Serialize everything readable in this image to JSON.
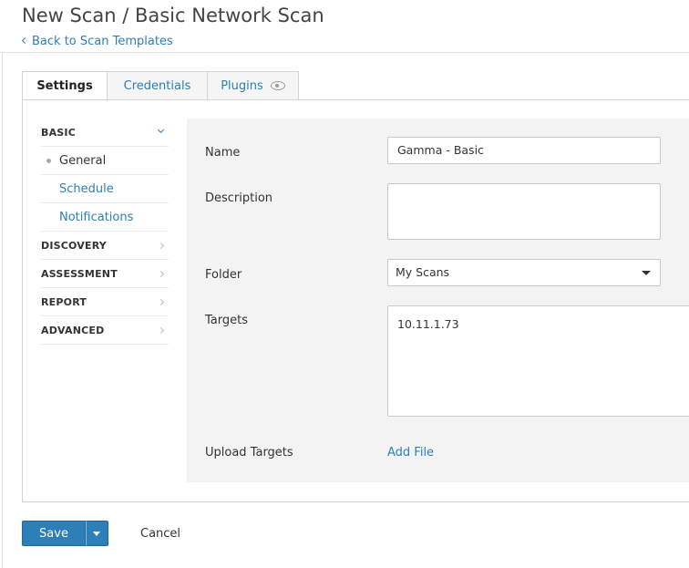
{
  "header": {
    "title": "New Scan / Basic Network Scan",
    "back_link": "Back to Scan Templates"
  },
  "tabs": [
    {
      "label": "Settings",
      "active": true
    },
    {
      "label": "Credentials",
      "active": false
    },
    {
      "label": "Plugins",
      "active": false,
      "icon": "eye-icon"
    }
  ],
  "sidebar": {
    "sections": [
      {
        "label": "BASIC",
        "expanded": true,
        "items": [
          {
            "label": "General",
            "current": true
          },
          {
            "label": "Schedule",
            "current": false
          },
          {
            "label": "Notifications",
            "current": false
          }
        ]
      },
      {
        "label": "DISCOVERY",
        "expanded": false
      },
      {
        "label": "ASSESSMENT",
        "expanded": false
      },
      {
        "label": "REPORT",
        "expanded": false
      },
      {
        "label": "ADVANCED",
        "expanded": false
      }
    ]
  },
  "form": {
    "name_label": "Name",
    "name_value": "Gamma - Basic",
    "description_label": "Description",
    "description_value": "",
    "folder_label": "Folder",
    "folder_value": "My Scans",
    "targets_label": "Targets",
    "targets_value": "10.11.1.73",
    "upload_label": "Upload Targets",
    "add_file_label": "Add File"
  },
  "actions": {
    "save_label": "Save",
    "cancel_label": "Cancel"
  },
  "colors": {
    "accent": "#2d7fb8",
    "form_bg": "#f3f3f3"
  }
}
